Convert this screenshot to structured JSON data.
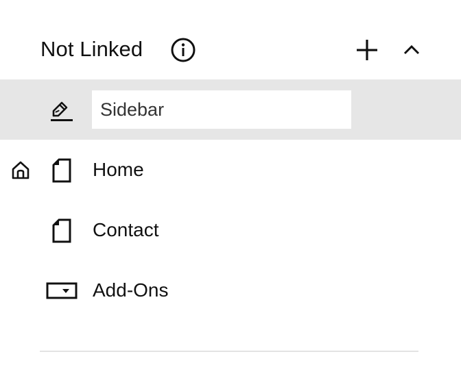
{
  "section": {
    "title": "Not Linked"
  },
  "icons": {
    "info": "info-icon",
    "add": "plus-icon",
    "collapse": "chevron-up-icon",
    "edit": "edit-icon",
    "home": "home-icon",
    "page": "page-icon",
    "addon": "dropdown-box-icon"
  },
  "rename": {
    "value": "Sidebar"
  },
  "pages": [
    {
      "label": "Home",
      "is_homepage": true
    },
    {
      "label": "Contact",
      "is_homepage": false
    },
    {
      "label": "Add-Ons",
      "is_homepage": false
    }
  ],
  "colors": {
    "selected_row_bg": "#e6e6e6",
    "divider": "#e3e3e3",
    "text": "#111111"
  }
}
